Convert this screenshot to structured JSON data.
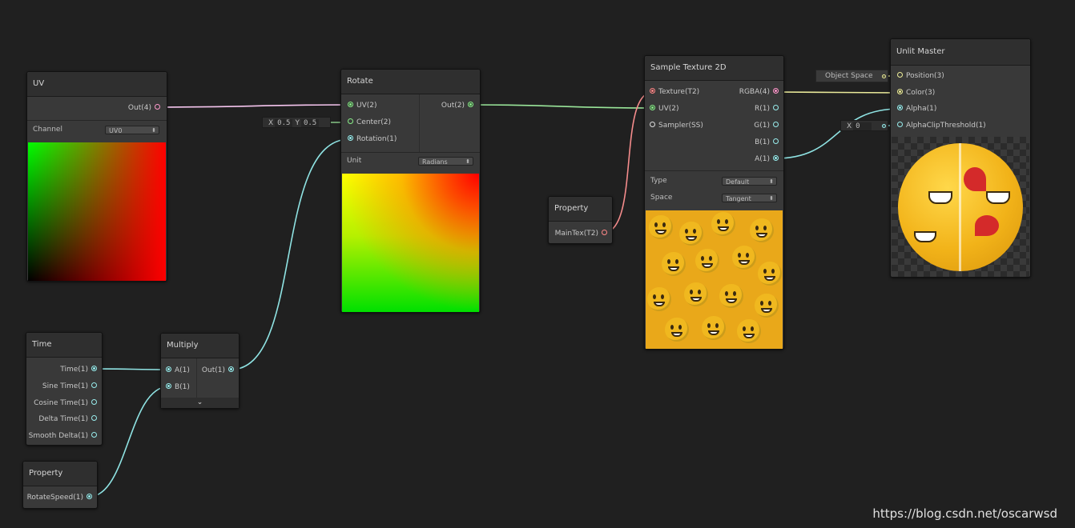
{
  "nodes": {
    "uv": {
      "title": "UV",
      "out": "Out(4)",
      "channel_label": "Channel",
      "channel_value": "UV0"
    },
    "rotate": {
      "title": "Rotate",
      "inputs": [
        "UV(2)",
        "Center(2)",
        "Rotation(1)"
      ],
      "out": "Out(2)",
      "unit_label": "Unit",
      "unit_value": "Radians",
      "center_x_label": "X",
      "center_x": "0.5",
      "center_y_label": "Y",
      "center_y": "0.5"
    },
    "time": {
      "title": "Time",
      "outputs": [
        "Time(1)",
        "Sine Time(1)",
        "Cosine Time(1)",
        "Delta Time(1)",
        "Smooth Delta(1)"
      ]
    },
    "multiply": {
      "title": "Multiply",
      "inputs": [
        "A(1)",
        "B(1)"
      ],
      "out": "Out(1)"
    },
    "property_rotate": {
      "title": "Property",
      "out": "RotateSpeed(1)"
    },
    "property_tex": {
      "title": "Property",
      "out": "MainTex(T2)"
    },
    "sample": {
      "title": "Sample Texture 2D",
      "inputs": [
        "Texture(T2)",
        "UV(2)",
        "Sampler(SS)"
      ],
      "outputs": [
        "RGBA(4)",
        "R(1)",
        "G(1)",
        "B(1)",
        "A(1)"
      ],
      "type_label": "Type",
      "type_value": "Default",
      "space_label": "Space",
      "space_value": "Tangent"
    },
    "master": {
      "title": "Unlit Master",
      "inputs": [
        "Position(3)",
        "Color(3)",
        "Alpha(1)",
        "AlphaClipThreshold(1)"
      ],
      "position_field": "Object Space",
      "alpha_clip_x_label": "X",
      "alpha_clip_x": "0"
    }
  },
  "colors": {
    "wire_uv": "#f6c6ef",
    "wire_v2": "#9ae69a",
    "wire_v1": "#8fe3e3",
    "wire_tex": "#f58c8c",
    "wire_color": "#eaea9a"
  },
  "watermark": "https://blog.csdn.net/oscarwsd"
}
